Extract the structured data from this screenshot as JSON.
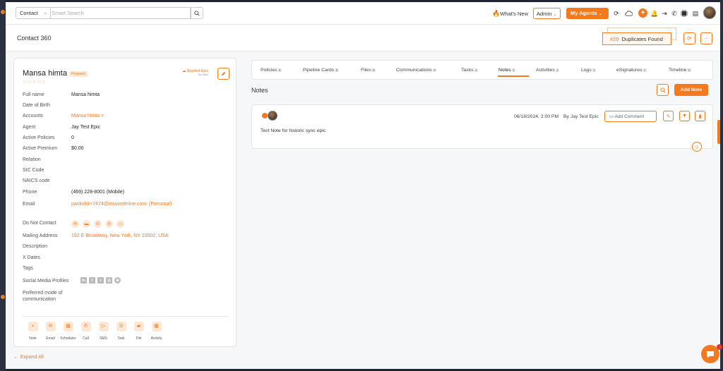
{
  "topbar": {
    "module_select": "Contact",
    "search_placeholder": "Smart Search",
    "whats_new": "What's New",
    "admin_select": "Admin",
    "my_agents": "My Agents"
  },
  "header": {
    "title": "Contact 360",
    "duplicates_count": "#29",
    "duplicates_label": "Duplicates Found"
  },
  "profile": {
    "name": "Mansa himta",
    "badge": "Prospect",
    "stars": "☆☆☆☆☆",
    "applied_epic": "Applied Epic",
    "applied_epic_sub": "Re-linked",
    "fields": [
      {
        "label": "Full name",
        "value": "Mansa himta"
      },
      {
        "label": "Date of Birth",
        "value": ""
      },
      {
        "label": "Accounts",
        "value": "Mansa himta >"
      },
      {
        "label": "Agent",
        "value": "Jay Test Epic"
      },
      {
        "label": "Active Policies",
        "value": "0"
      },
      {
        "label": "Active Premium",
        "value": "$0.00"
      },
      {
        "label": "Relation",
        "value": ""
      },
      {
        "label": "SIC Code",
        "value": ""
      },
      {
        "label": "NAICS code",
        "value": ""
      },
      {
        "label": "Phone",
        "value": "(469) 228-8001 (Mobile)"
      },
      {
        "label": "Email",
        "value": "parikshit+7474@insuredmine.com: (Personal)"
      },
      {
        "label": "Do Not Contact",
        "value": ""
      },
      {
        "label": "Mailing Address",
        "value": "152 E Broadway, New York, NY 10002, USA"
      },
      {
        "label": "Description",
        "value": ""
      },
      {
        "label": "X Dates",
        "value": ""
      },
      {
        "label": "Tags",
        "value": ""
      },
      {
        "label": "Social Media Profiles",
        "value": ""
      },
      {
        "label": "Preferred mode of",
        "value": ""
      },
      {
        "label": "communication",
        "value": ""
      }
    ],
    "actions": [
      {
        "label": "Note",
        "icon": "note-icon"
      },
      {
        "label": "Email",
        "icon": "email-icon"
      },
      {
        "label": "Scheduler",
        "icon": "calendar-icon"
      },
      {
        "label": "Call",
        "icon": "phone-icon"
      },
      {
        "label": "SMS",
        "icon": "sms-icon"
      },
      {
        "label": "Task",
        "icon": "task-icon"
      },
      {
        "label": "File",
        "icon": "folder-icon"
      },
      {
        "label": "Activity",
        "icon": "activity-icon"
      }
    ],
    "expand_all": "Expand All"
  },
  "tabs": [
    {
      "label": "Policies",
      "count": "0"
    },
    {
      "label": "Pipeline Cards",
      "count": "0"
    },
    {
      "label": "Files",
      "count": "0"
    },
    {
      "label": "Communications",
      "count": "0"
    },
    {
      "label": "Tasks",
      "count": "1"
    },
    {
      "label": "Notes",
      "count": "1"
    },
    {
      "label": "Activities",
      "count": "1"
    },
    {
      "label": "Logs",
      "count": "1"
    },
    {
      "label": "eSignatures",
      "count": "1"
    },
    {
      "label": "Timeline",
      "count": "0"
    }
  ],
  "notes": {
    "title": "Notes",
    "add_note": "Add Note",
    "items": [
      {
        "date": "06/18/2024, 2:00 PM",
        "author": "By Jay Test Epic",
        "add_comment": "Add Comment",
        "text": "Test Note for historic sync epic"
      }
    ]
  },
  "colors": {
    "accent": "#f47a20",
    "accent_light": "#fde8d6"
  }
}
